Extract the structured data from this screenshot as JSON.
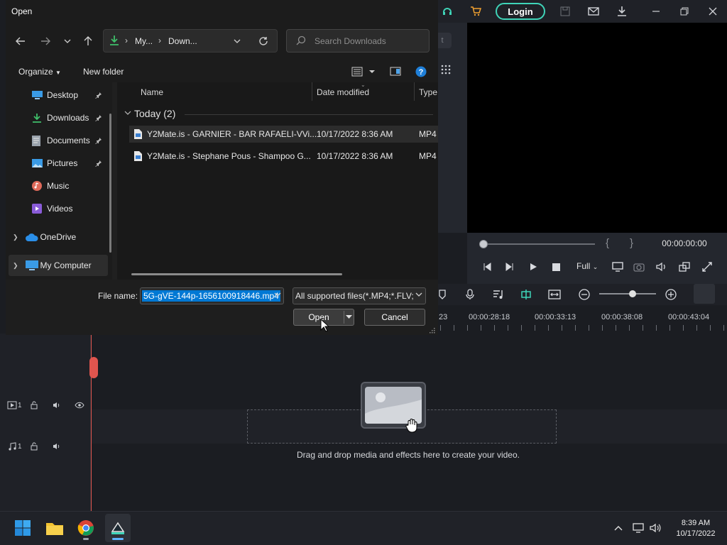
{
  "editor": {
    "login_label": "Login",
    "timecode": "00:00:00:00",
    "zoom_mode": "Full",
    "ruler_times": [
      "23",
      "00:00:28:18",
      "00:00:33:13",
      "00:00:38:08",
      "00:00:43:04"
    ],
    "video_track_label": "1",
    "audio_track_label": "1",
    "drop_hint": "Drag and drop media and effects here to create your video.",
    "search_partial": "t"
  },
  "dialog": {
    "title": "Open",
    "breadcrumb": [
      "My...",
      "Down..."
    ],
    "search_placeholder": "Search Downloads",
    "organize_label": "Organize",
    "new_folder_label": "New folder",
    "sidebar": [
      {
        "label": "Desktop",
        "icon": "desktop-icon",
        "pinned": true
      },
      {
        "label": "Downloads",
        "icon": "download-icon",
        "pinned": true
      },
      {
        "label": "Documents",
        "icon": "document-icon",
        "pinned": true
      },
      {
        "label": "Pictures",
        "icon": "picture-icon",
        "pinned": true
      },
      {
        "label": "Music",
        "icon": "music-icon",
        "pinned": false
      },
      {
        "label": "Videos",
        "icon": "video-icon",
        "pinned": false
      },
      {
        "label": "OneDrive",
        "icon": "cloud-icon",
        "pinned": false
      },
      {
        "label": "My Computer",
        "icon": "computer-icon",
        "pinned": false
      }
    ],
    "columns": [
      "Name",
      "Date modified",
      "Type"
    ],
    "group_label": "Today (2)",
    "files": [
      {
        "name": "Y2Mate.is - GARNIER - BAR RAFAELI-VVi...",
        "date": "10/17/2022 8:36 AM",
        "type": "MP4"
      },
      {
        "name": "Y2Mate.is - Stephane Pous - Shampoo G...",
        "date": "10/17/2022 8:36 AM",
        "type": "MP4"
      }
    ],
    "file_name_label": "File name:",
    "file_name_value": "5G-gVE-144p-1656100918446.mp4",
    "file_type_value": "All supported files(*.MP4;*.FLV;",
    "open_label": "Open",
    "cancel_label": "Cancel"
  },
  "taskbar": {
    "time": "8:39 AM",
    "date": "10/17/2022"
  },
  "colors": {
    "accent": "#3fd4b8",
    "selection": "#0078d4",
    "playhead": "#e0554e"
  }
}
